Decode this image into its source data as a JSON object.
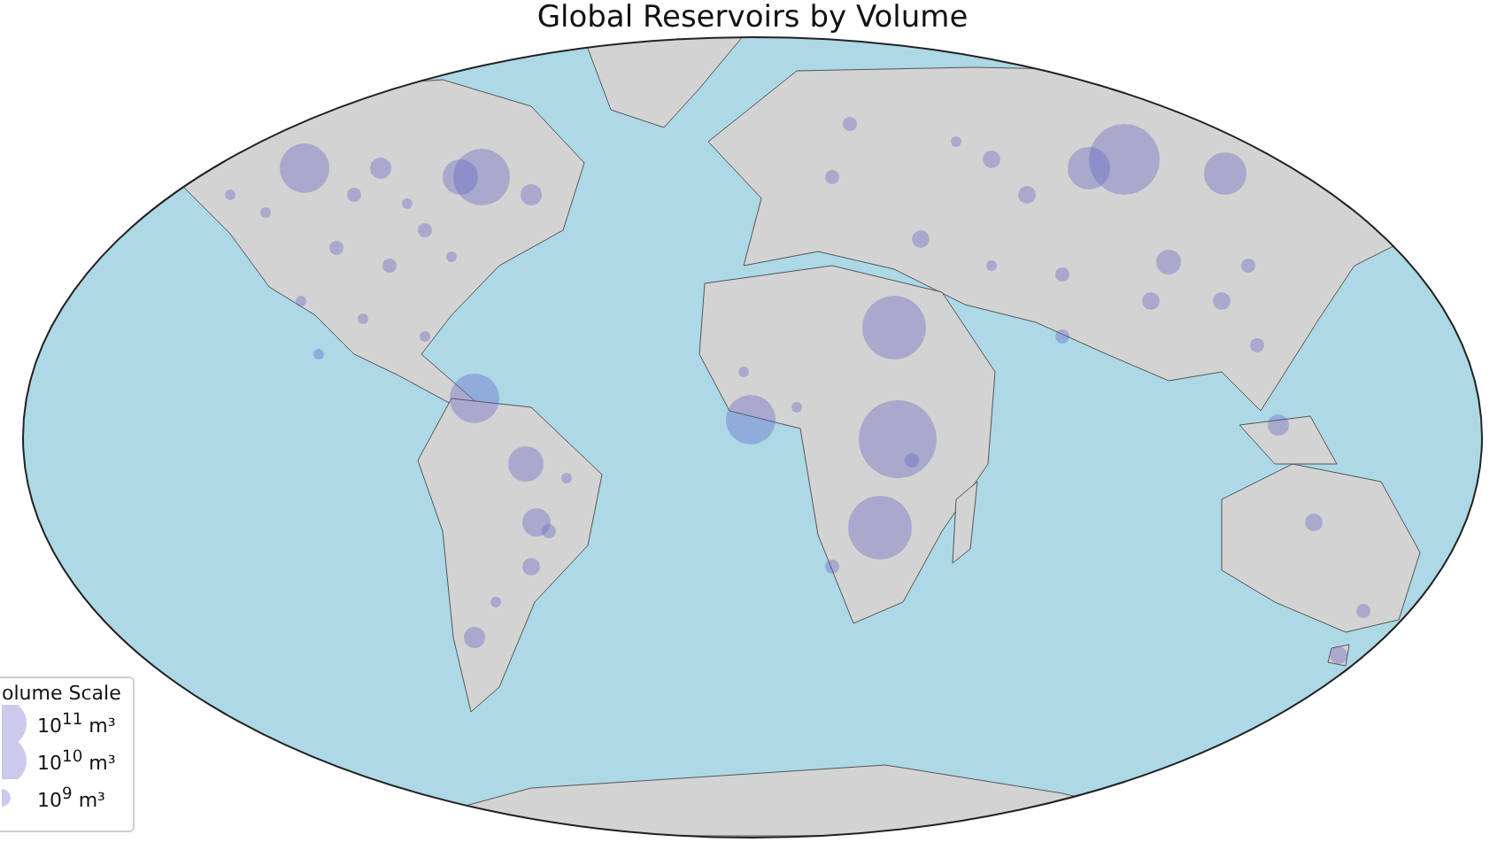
{
  "title": "Global Reservoirs by Volume",
  "legend": {
    "title": "olume Scale",
    "entries": [
      {
        "label": "10$^{11}$ m³"
      },
      {
        "label": "10$^{10}$ m³"
      },
      {
        "label": "10$^{9}$ m³"
      }
    ]
  }
}
